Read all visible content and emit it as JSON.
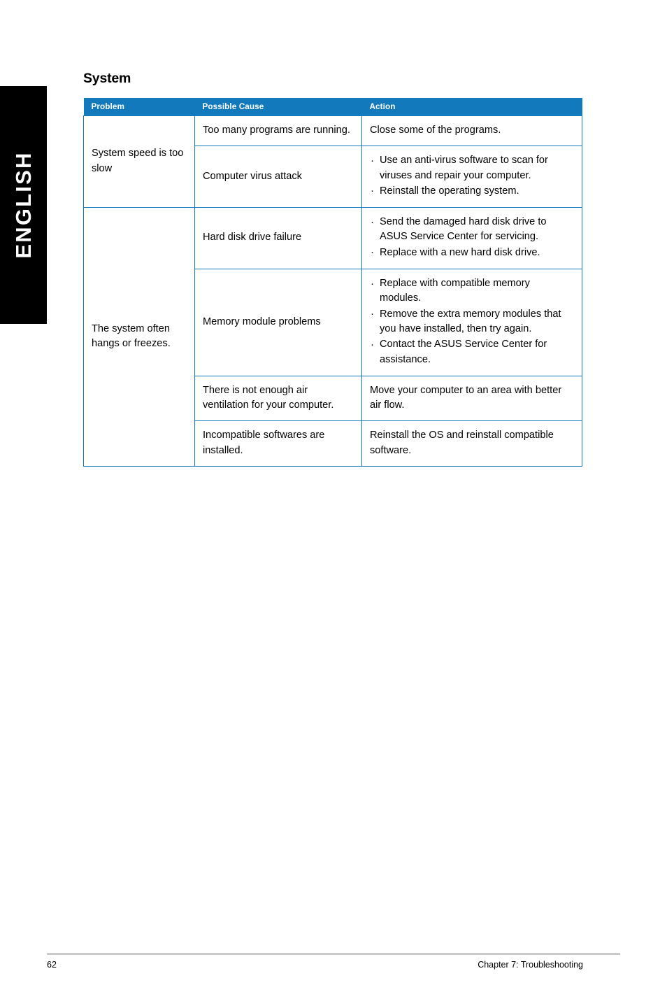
{
  "colors": {
    "header_blue": "#1279bd",
    "border_blue": "#1479bc",
    "tab_black": "#000000",
    "rule_grey": "#c9c9c9"
  },
  "language_tab": {
    "label": "ENGLISH"
  },
  "section": {
    "title": "System"
  },
  "table": {
    "headers": [
      "Problem",
      "Possible Cause",
      "Action"
    ],
    "rows": [
      {
        "problem": "System speed is too slow",
        "problem_rowspan": 2,
        "cause": "Too many programs are running.",
        "action_type": "plain",
        "action": "Close some of the programs."
      },
      {
        "problem": null,
        "cause": "Computer virus attack",
        "action_type": "bullets",
        "action_items": [
          "Use an anti-virus software to scan for viruses and repair your computer.",
          "Reinstall the operating system."
        ]
      },
      {
        "problem": "The system often hangs or freezes.",
        "problem_rowspan": 4,
        "cause": "Hard disk drive failure",
        "action_type": "bullets",
        "action_items": [
          "Send the damaged hard disk drive to ASUS Service Center for servicing.",
          "Replace with a new hard disk drive."
        ]
      },
      {
        "problem": null,
        "cause": "Memory module problems",
        "action_type": "bullets",
        "action_items": [
          "Replace with compatible memory modules.",
          "Remove the extra memory modules that you have installed, then try again.",
          "Contact the ASUS Service Center for assistance."
        ]
      },
      {
        "problem": null,
        "cause": "There is not enough air ventilation for your computer.",
        "action_type": "plain",
        "action": "Move your computer to an area with better air flow."
      },
      {
        "problem": null,
        "cause": "Incompatible softwares are installed.",
        "action_type": "plain",
        "action": "Reinstall the OS and reinstall compatible software."
      }
    ]
  },
  "footer": {
    "page_number": "62",
    "chapter": "Chapter 7: Troubleshooting"
  }
}
